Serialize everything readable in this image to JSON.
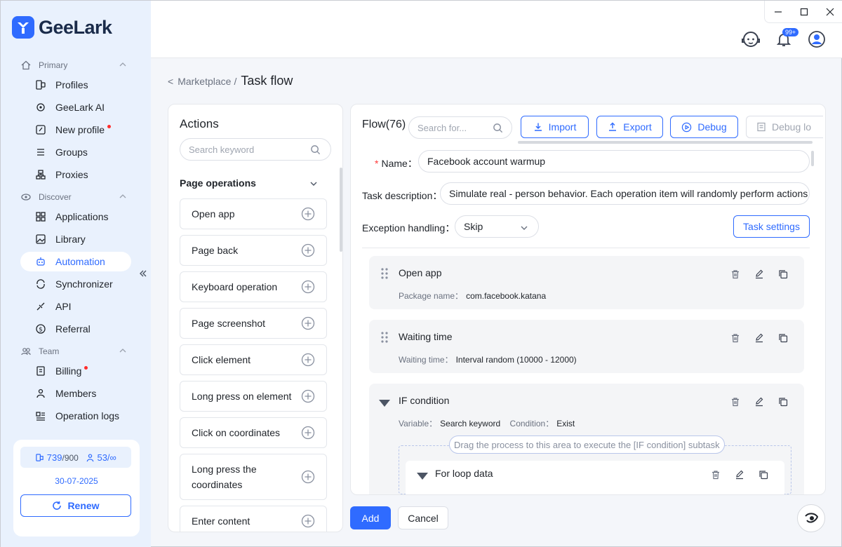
{
  "app": {
    "name": "GeeLark"
  },
  "window_controls": {
    "minimize": "minimize",
    "maximize": "maximize",
    "close": "close"
  },
  "topbar": {
    "notification_badge": "99+"
  },
  "sidebar": {
    "sections": [
      {
        "label": "Primary",
        "items": [
          {
            "label": "Profiles",
            "icon": "profiles-icon"
          },
          {
            "label": "GeeLark AI",
            "icon": "ai-icon"
          },
          {
            "label": "New profile",
            "icon": "new-profile-icon",
            "dot": true
          },
          {
            "label": "Groups",
            "icon": "groups-icon"
          },
          {
            "label": "Proxies",
            "icon": "proxies-icon"
          }
        ]
      },
      {
        "label": "Discover",
        "items": [
          {
            "label": "Applications",
            "icon": "applications-icon"
          },
          {
            "label": "Library",
            "icon": "library-icon"
          },
          {
            "label": "Automation",
            "icon": "robot-icon",
            "active": true
          },
          {
            "label": "Synchronizer",
            "icon": "synchronizer-icon"
          },
          {
            "label": "API",
            "icon": "api-icon"
          },
          {
            "label": "Referral",
            "icon": "referral-icon"
          }
        ]
      },
      {
        "label": "Team",
        "items": [
          {
            "label": "Billing",
            "icon": "billing-icon",
            "dot": true
          },
          {
            "label": "Members",
            "icon": "members-icon"
          },
          {
            "label": "Operation logs",
            "icon": "operation-logs-icon"
          }
        ]
      }
    ],
    "quota": {
      "profiles_used": "739",
      "profiles_total": "/900",
      "members_used": "53/",
      "members_total": "∞",
      "date": "30-07-2025",
      "renew_label": "Renew"
    }
  },
  "breadcrumb": {
    "parent": "Marketplace",
    "separator": "/",
    "current": "Task flow"
  },
  "actions": {
    "title": "Actions",
    "search_placeholder": "Search keyword",
    "group": "Page operations",
    "items": [
      "Open app",
      "Page back",
      "Keyboard operation",
      "Page screenshot",
      "Click element",
      "Long press on element",
      "Click on coordinates",
      "Long press the coordinates",
      "Enter content"
    ]
  },
  "flow": {
    "title": "Flow(76)",
    "search_placeholder": "Search for...",
    "toolbar": {
      "import": "Import",
      "export": "Export",
      "debug": "Debug",
      "debug_log": "Debug lo"
    },
    "name_label": "Name",
    "name_value": "Facebook account warmup",
    "desc_label": "Task description",
    "desc_value": "Simulate real - person behavior. Each operation item will randomly perform actions",
    "exception_label": "Exception handling",
    "exception_value": "Skip",
    "task_settings": "Task settings",
    "steps": [
      {
        "title": "Open app",
        "meta": [
          {
            "k": "Package name：",
            "v": "com.facebook.katana"
          }
        ]
      },
      {
        "title": "Waiting time",
        "meta": [
          {
            "k": "Waiting time：",
            "v": "Interval random (10000 - 12000)"
          }
        ]
      },
      {
        "title": "IF condition",
        "meta": [
          {
            "k": "Variable：",
            "v": "Search keyword"
          },
          {
            "k": "Condition：",
            "v": "Exist"
          }
        ],
        "drop_hint": "Drag the process to this area to execute the [IF condition] subtask",
        "child": {
          "title": "For loop data"
        }
      }
    ]
  },
  "footer": {
    "add": "Add",
    "cancel": "Cancel"
  },
  "colors": {
    "accent": "#2f6bff",
    "sidebar_bg": "#e9f1fd",
    "notification_dot": "#ff2d2d"
  }
}
